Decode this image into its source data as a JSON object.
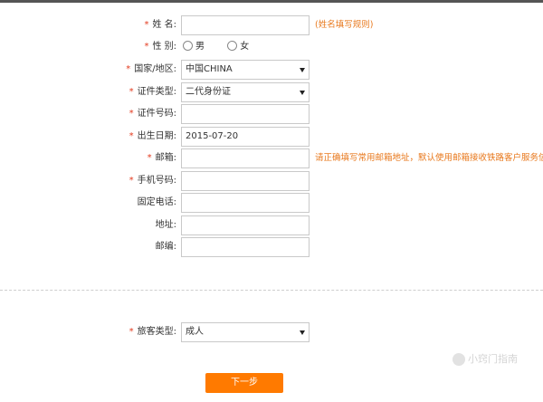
{
  "form": {
    "name": {
      "label": "姓 名:",
      "value": "",
      "hint": "(姓名填写规则)"
    },
    "gender": {
      "label": "性 别:",
      "options": [
        "男",
        "女"
      ]
    },
    "country": {
      "label": "国家/地区:",
      "value": "中国CHINA"
    },
    "id_type": {
      "label": "证件类型:",
      "value": "二代身份证"
    },
    "id_number": {
      "label": "证件号码:",
      "value": ""
    },
    "birth_date": {
      "label": "出生日期:",
      "value": "2015-07-20"
    },
    "email": {
      "label": "邮箱:",
      "value": "",
      "hint": "请正确填写常用邮箱地址，默认使用邮箱接收铁路客户服务信息"
    },
    "mobile": {
      "label": "手机号码:",
      "value": ""
    },
    "landline": {
      "label": "固定电话:",
      "value": ""
    },
    "address": {
      "label": "地址:",
      "value": ""
    },
    "postcode": {
      "label": "邮编:",
      "value": ""
    },
    "passenger_type": {
      "label": "旅客类型:",
      "value": "成人"
    }
  },
  "required_marker": "*",
  "next_button": "下一步",
  "watermark": "小窍门指南",
  "colors": {
    "accent": "#ff7a00",
    "required": "#e33a1e",
    "hint": "#e8781c"
  }
}
